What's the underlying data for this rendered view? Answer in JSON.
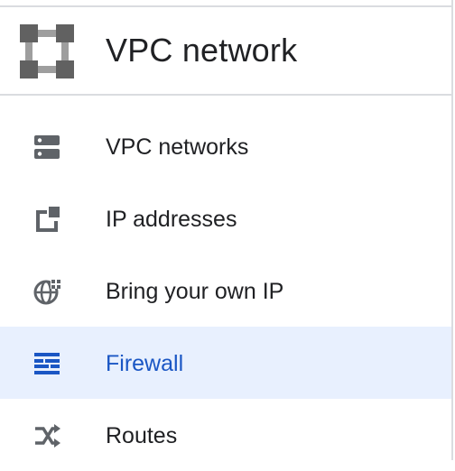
{
  "header": {
    "title": "VPC network",
    "icon": "vpc-network-icon"
  },
  "nav": {
    "items": [
      {
        "label": "VPC networks",
        "icon": "vpc-networks-icon",
        "active": false
      },
      {
        "label": "IP addresses",
        "icon": "ip-addresses-icon",
        "active": false
      },
      {
        "label": "Bring your own IP",
        "icon": "globe-icon",
        "active": false
      },
      {
        "label": "Firewall",
        "icon": "firewall-icon",
        "active": true
      },
      {
        "label": "Routes",
        "icon": "routes-icon",
        "active": false
      }
    ]
  },
  "colors": {
    "active_bg": "#e8f0fe",
    "active_text": "#1a56c4",
    "icon_gray": "#5f6368",
    "header_icon": "#757575"
  }
}
